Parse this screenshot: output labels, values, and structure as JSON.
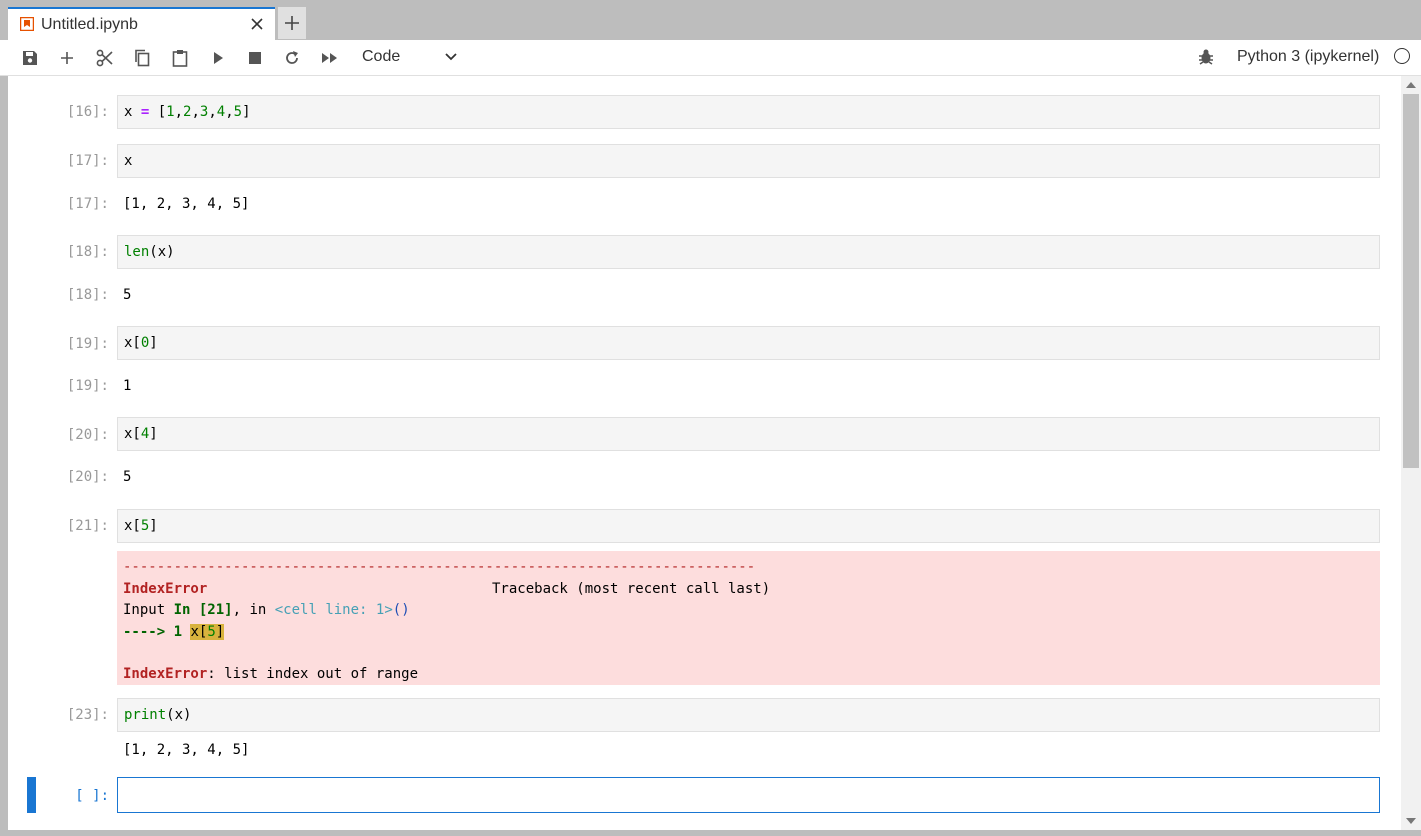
{
  "tab": {
    "title": "Untitled.ipynb"
  },
  "toolbar": {
    "cell_type": "Code",
    "kernel_name": "Python 3 (ipykernel)"
  },
  "colors": {
    "accent": "#1976d2",
    "error_bg": "#fddddd",
    "cell_bg": "#f5f5f5"
  },
  "icons": [
    "notebook-icon",
    "close-icon",
    "plus-icon",
    "save-icon",
    "insert-cell-icon",
    "cut-icon",
    "copy-icon",
    "paste-icon",
    "run-icon",
    "stop-icon",
    "restart-icon",
    "run-all-icon",
    "chevron-down-icon",
    "debugger-icon",
    "kernel-status-icon"
  ],
  "cells": [
    {
      "in_prompt": "[16]:",
      "code": "x = [1,2,3,4,5]"
    },
    {
      "in_prompt": "[17]:",
      "code": "x",
      "out_prompt": "[17]:",
      "output": "[1, 2, 3, 4, 5]"
    },
    {
      "in_prompt": "[18]:",
      "code": "len(x)",
      "out_prompt": "[18]:",
      "output": "5"
    },
    {
      "in_prompt": "[19]:",
      "code": "x[0]",
      "out_prompt": "[19]:",
      "output": "1"
    },
    {
      "in_prompt": "[20]:",
      "code": "x[4]",
      "out_prompt": "[20]:",
      "output": "5"
    },
    {
      "in_prompt": "[21]:",
      "code": "x[5]"
    },
    {
      "in_prompt": "[23]:",
      "code": "print(x)",
      "output": "[1, 2, 3, 4, 5]"
    },
    {
      "in_prompt": "[ ]:",
      "code": ""
    }
  ],
  "error": {
    "dashes": "---------------------------------------------------------------------------",
    "name": "IndexError",
    "traceback_label": "Traceback (most recent call last)",
    "input_prefix": "Input ",
    "in_label": "In [21]",
    "in_suffix": ", in ",
    "cell_line": "<cell line: 1>",
    "paren": "()",
    "arrow": "----> 1 ",
    "code_before": "x",
    "code_hl_open": "[",
    "code_hl_num": "5",
    "code_hl_close": "]",
    "message_name": "IndexError",
    "message": ": list index out of range"
  }
}
